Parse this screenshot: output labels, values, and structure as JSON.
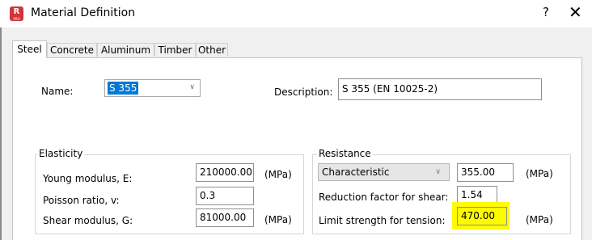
{
  "window": {
    "title": "Material Definition",
    "help_label": "?",
    "close_label": "✕",
    "app_icon_letter": "R",
    "app_icon_sub": "PRO"
  },
  "tabs": [
    {
      "label": "Steel",
      "active": true
    },
    {
      "label": "Concrete",
      "active": false
    },
    {
      "label": "Aluminum",
      "active": false
    },
    {
      "label": "Timber",
      "active": false
    },
    {
      "label": "Other",
      "active": false
    }
  ],
  "name_field": {
    "label": "Name:",
    "value": "S 355"
  },
  "description_field": {
    "label": "Description:",
    "value": "S 355 (EN 10025-2)"
  },
  "elasticity": {
    "title": "Elasticity",
    "rows": [
      {
        "label": "Young modulus, E:",
        "value": "210000.00",
        "unit": "(MPa)"
      },
      {
        "label": "Poisson ratio, v:",
        "value": "0.3",
        "unit": ""
      },
      {
        "label": "Shear modulus, G:",
        "value": "81000.00",
        "unit": "(MPa)"
      }
    ]
  },
  "resistance": {
    "title": "Resistance",
    "type_select": "Characteristic",
    "characteristic_value": "355.00",
    "characteristic_unit": "(MPa)",
    "shear_label": "Reduction factor for shear:",
    "shear_value": "1.54",
    "tension_label": "Limit strength for tension:",
    "tension_value": "470.00",
    "tension_unit": "(MPa)"
  },
  "colors": {
    "accent_selection": "#0078d7",
    "app_icon": "#d0343c",
    "highlight": "#fffb00"
  }
}
